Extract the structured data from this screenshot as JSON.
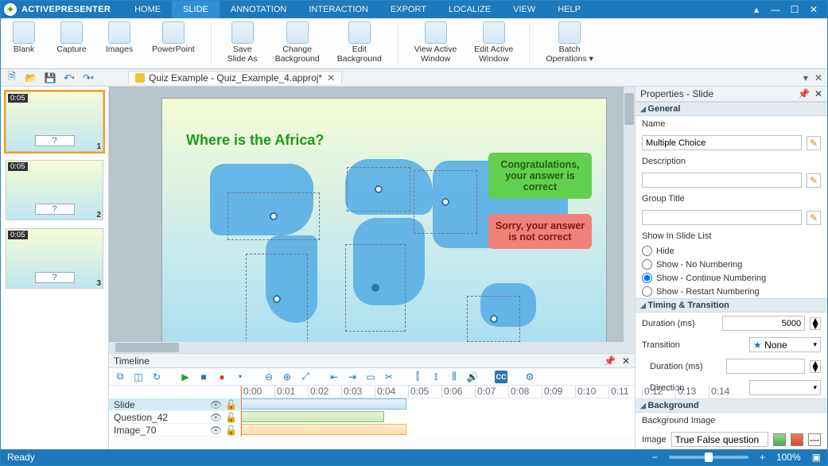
{
  "window": {
    "brand": "ACTIVEPRESENTER"
  },
  "menu": {
    "tabs": [
      "HOME",
      "SLIDE",
      "ANNOTATION",
      "INTERACTION",
      "EXPORT",
      "LOCALIZE",
      "VIEW",
      "HELP"
    ],
    "active": 1
  },
  "ribbon": {
    "items": [
      {
        "label": "Blank"
      },
      {
        "label": "Capture"
      },
      {
        "label": "Images"
      },
      {
        "label": "PowerPoint"
      },
      {
        "sep": true
      },
      {
        "label": "Save\nSlide As"
      },
      {
        "label": "Change\nBackground"
      },
      {
        "label": "Edit\nBackground"
      },
      {
        "sep": true
      },
      {
        "label": "View Active\nWindow"
      },
      {
        "label": "Edit Active\nWindow"
      },
      {
        "sep": true
      },
      {
        "label": "Batch\nOperations ▾"
      }
    ]
  },
  "doc": {
    "title": "Quiz Example - Quiz_Example_4.approj*"
  },
  "thumbs": [
    {
      "dur": "0:05",
      "num": 1,
      "active": true
    },
    {
      "dur": "0:05",
      "num": 2,
      "active": false
    },
    {
      "dur": "0:05",
      "num": 3,
      "active": false
    }
  ],
  "slide": {
    "question": "Where is the Africa?",
    "ok": "Congratulations, your answer is correct",
    "no": "Sorry, your answer is not correct"
  },
  "timeline": {
    "title": "Timeline",
    "ticks": [
      "0:00",
      "0:01",
      "0:02",
      "0:03",
      "0:04",
      "0:05",
      "0:06",
      "0:07",
      "0:08",
      "0:09",
      "0:10",
      "0:11",
      "0:12",
      "0:13",
      "0:14"
    ],
    "tracks": [
      "Slide",
      "Question_42",
      "Image_70"
    ]
  },
  "props": {
    "title": "Properties - Slide",
    "general": {
      "label": "General",
      "name_label": "Name",
      "name": "Multiple Choice",
      "desc_label": "Description",
      "desc": "",
      "group_label": "Group Title",
      "group": ""
    },
    "showlist": {
      "label": "Show In Slide List",
      "opts": [
        "Hide",
        "Show - No Numbering",
        "Show - Continue Numbering",
        "Show - Restart Numbering"
      ],
      "selected": 2
    },
    "timing": {
      "label": "Timing & Transition",
      "dur_label": "Duration (ms)",
      "dur": "5000",
      "trans_label": "Transition",
      "trans": "None",
      "tdur_label": "Duration (ms)",
      "tdur": "",
      "dir_label": "Direction",
      "dir": ""
    },
    "bg": {
      "label": "Background",
      "bgimg_label": "Background Image",
      "img_label": "Image",
      "img": "True False question"
    }
  },
  "status": {
    "ready": "Ready",
    "zoom": "100%"
  }
}
